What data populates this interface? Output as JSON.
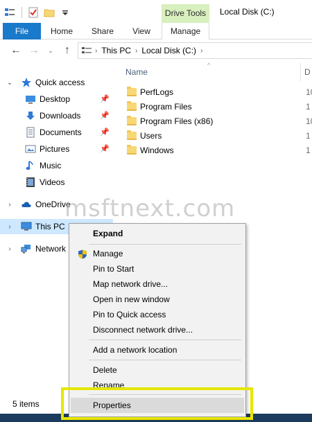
{
  "title_bar": {
    "contextual_tab": "Drive Tools",
    "window_title": "Local Disk (C:)"
  },
  "ribbon": {
    "tabs": [
      {
        "label": "File"
      },
      {
        "label": "Home"
      },
      {
        "label": "Share"
      },
      {
        "label": "View"
      },
      {
        "label": "Manage"
      }
    ]
  },
  "address": {
    "breadcrumb": [
      "This PC",
      "Local Disk (C:)"
    ]
  },
  "nav_pane": {
    "items": [
      {
        "label": "Quick access",
        "icon": "star-icon"
      },
      {
        "label": "Desktop",
        "icon": "desktop-icon",
        "pinned": true
      },
      {
        "label": "Downloads",
        "icon": "download-icon",
        "pinned": true
      },
      {
        "label": "Documents",
        "icon": "documents-icon",
        "pinned": true
      },
      {
        "label": "Pictures",
        "icon": "pictures-icon",
        "pinned": true
      },
      {
        "label": "Music",
        "icon": "music-icon"
      },
      {
        "label": "Videos",
        "icon": "videos-icon"
      },
      {
        "label": "OneDrive",
        "icon": "cloud-icon"
      },
      {
        "label": "This PC",
        "icon": "computer-icon"
      },
      {
        "label": "Network",
        "icon": "network-icon"
      }
    ]
  },
  "file_list": {
    "column_name": "Name",
    "column_date": "D",
    "rows": [
      {
        "name": "PerfLogs",
        "date": "10"
      },
      {
        "name": "Program Files",
        "date": "1"
      },
      {
        "name": "Program Files (x86)",
        "date": "10"
      },
      {
        "name": "Users",
        "date": "1"
      },
      {
        "name": "Windows",
        "date": "1"
      }
    ]
  },
  "status_bar": {
    "item_count": "5 items"
  },
  "watermark": "msftnext.com",
  "context_menu": {
    "items": [
      {
        "label": "Expand"
      },
      {
        "label": "Manage"
      },
      {
        "label": "Pin to Start"
      },
      {
        "label": "Map network drive..."
      },
      {
        "label": "Open in new window"
      },
      {
        "label": "Pin to Quick access"
      },
      {
        "label": "Disconnect network drive..."
      },
      {
        "label": "Add a network location"
      },
      {
        "label": "Delete"
      },
      {
        "label": "Rename"
      },
      {
        "label": "Properties"
      }
    ]
  },
  "colors": {
    "file_tab": "#1979ca",
    "drive_tools_tab": "#d8efbe",
    "selection": "#cde8ff",
    "highlight_box": "#e6e600"
  }
}
